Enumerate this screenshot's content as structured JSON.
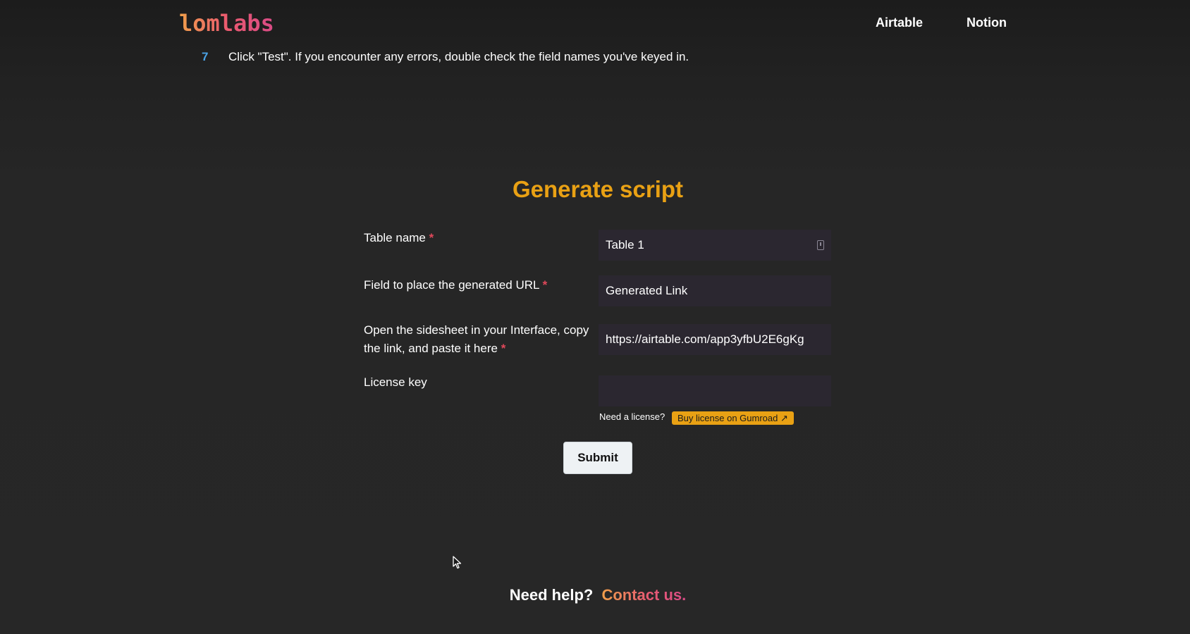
{
  "header": {
    "logo": "lomlabs",
    "nav": [
      "Airtable",
      "Notion"
    ]
  },
  "step": {
    "number": "7",
    "text": "Click \"Test\". If you encounter any errors, double check the field names you've keyed in."
  },
  "form": {
    "title": "Generate script",
    "fields": [
      {
        "label": "Table name",
        "required": "*",
        "value": "Table 1"
      },
      {
        "label": "Field to place the generated URL",
        "required": "*",
        "value": "Generated Link"
      },
      {
        "label": "Open the sidesheet in your Interface, copy the link, and paste it here",
        "required": "*",
        "value": "https://airtable.com/app3yfbU2E6gKg"
      },
      {
        "label": "License key",
        "required": "",
        "value": ""
      }
    ],
    "license_hint": "Need a license?",
    "gumroad_label": "Buy license on Gumroad ↗",
    "submit_label": "Submit"
  },
  "footer": {
    "question": "Need help?",
    "contact": "Contact us."
  },
  "colors": {
    "accent": "#e9a114",
    "required": "#e0485a",
    "step_number": "#4aa3e6"
  }
}
